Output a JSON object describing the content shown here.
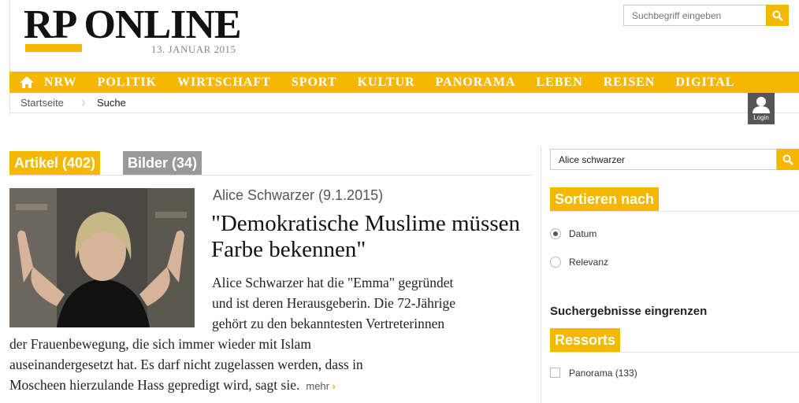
{
  "header": {
    "logo_text": "RP ONLINE",
    "date": "13. JANUAR 2015",
    "search_placeholder": "Suchbegriff eingeben"
  },
  "nav": {
    "items": [
      "NRW",
      "POLITIK",
      "WIRTSCHAFT",
      "SPORT",
      "KULTUR",
      "PANORAMA",
      "LEBEN",
      "REISEN",
      "DIGITAL"
    ]
  },
  "breadcrumb": {
    "home": "Startseite",
    "current": "Suche"
  },
  "login": {
    "label": "Login"
  },
  "tabs": {
    "articles": "Artikel (402)",
    "images": "Bilder (34)"
  },
  "article": {
    "kicker": "Alice Schwarzer (9.1.2015)",
    "headline": "\"Demokratische Muslime müssen Farbe bekennen\"",
    "teaser_lines": [
      "Alice Schwarzer hat die \"Emma\" gegründet",
      "und ist deren Herausgeberin. Die 72-Jährige",
      "gehört zu den bekanntesten Vertreterinnen",
      "der Frauenbewegung, die sich immer wieder mit Islam",
      "auseinandergesetzt hat. Es darf nicht zugelassen werden, dass in",
      "Moscheen hierzulande Hass gepredigt wird, sagt sie."
    ],
    "more": "mehr"
  },
  "sidebar": {
    "search_value": "Alice schwarzer",
    "sort_heading": "Sortieren nach",
    "sort_options": [
      "Datum",
      "Relevanz"
    ],
    "sort_selected": "Datum",
    "refine_heading": "Suchergebnisse eingrenzen",
    "ressorts_heading": "Ressorts",
    "ressort_items": [
      "Panorama (133)"
    ]
  },
  "colors": {
    "accent": "#f5b800",
    "inactive_tab": "#999999"
  }
}
